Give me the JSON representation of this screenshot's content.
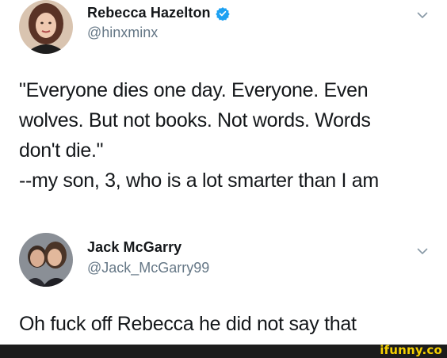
{
  "tweets": [
    {
      "display_name": "Rebecca Hazelton",
      "verified": true,
      "handle": "@hinxminx",
      "text_lines": [
        "\"Everyone dies one day. Everyone. Even",
        "wolves. But not books. Not words. Words",
        "don't die.\"",
        "--my son, 3, who is a lot smarter than I am"
      ],
      "avatar_icon": "profile-photo-woman"
    },
    {
      "display_name": "Jack McGarry",
      "verified": false,
      "handle": "@Jack_McGarry99",
      "text_lines": [
        "Oh fuck off Rebecca he did not say that"
      ],
      "avatar_icon": "profile-photo-couple"
    }
  ],
  "icons": {
    "verified": "verified-badge-icon",
    "caret": "chevron-down-icon"
  },
  "colors": {
    "text": "#14171a",
    "handle": "#657786",
    "verified_blue": "#1da1f2",
    "watermark_yellow": "#f5d000",
    "footer_bar": "#1c1c1c"
  },
  "watermark": {
    "text": "ifunny.co"
  }
}
